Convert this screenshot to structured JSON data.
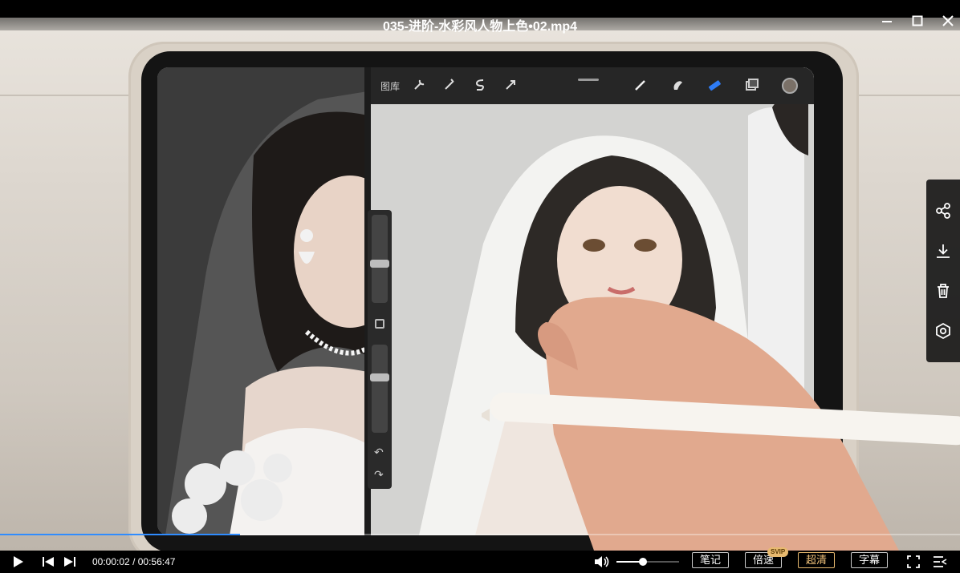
{
  "window": {
    "title": "035-进阶-水彩风人物上色•02.mp4"
  },
  "video_frame": {
    "app_toolbar": {
      "gallery_label": "图库"
    }
  },
  "playback": {
    "current_time": "00:00:02",
    "duration": "00:56:47",
    "separator": "/",
    "progress_percent": 25,
    "volume_percent": 42
  },
  "controls": {
    "notes_label": "笔记",
    "speed_label": "倍速",
    "speed_badge": "SVIP",
    "quality_label": "超清",
    "subtitle_label": "字幕"
  },
  "side_actions": [
    "share-icon",
    "download-icon",
    "delete-icon",
    "settings-icon"
  ],
  "colors": {
    "progress": "#2f8cff",
    "accent_gold": "#e7b96f"
  }
}
